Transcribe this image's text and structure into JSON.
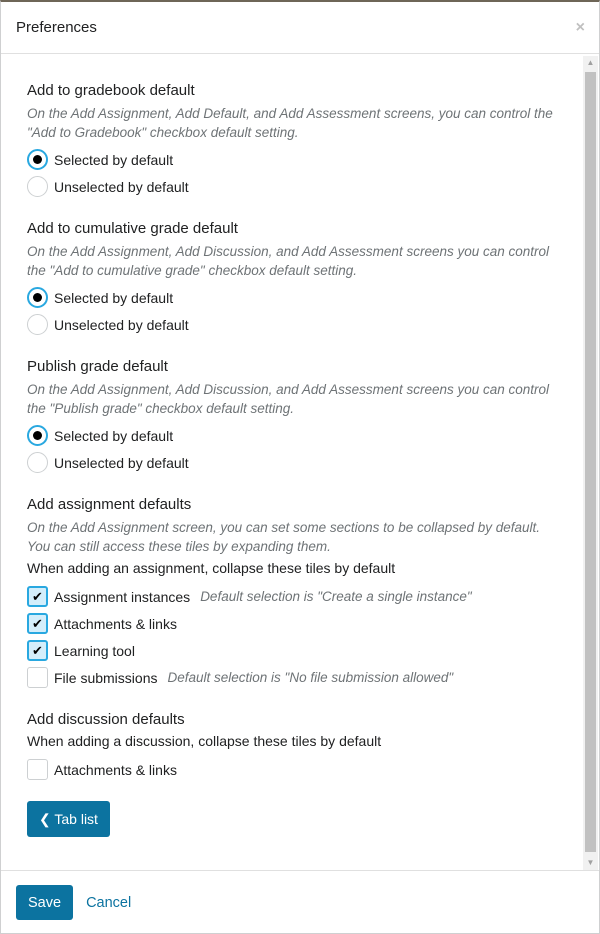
{
  "dialog": {
    "title": "Preferences",
    "close_icon": "×"
  },
  "sections": [
    {
      "heading": "Add to gradebook default",
      "description": "On the Add Assignment, Add Default, and Add Assessment screens, you can control the \"Add to Gradebook\" checkbox default setting.",
      "options": [
        {
          "label": "Selected by default",
          "checked": true
        },
        {
          "label": "Unselected by default",
          "checked": false
        }
      ]
    },
    {
      "heading": "Add to cumulative grade default",
      "description": "On the Add Assignment, Add Discussion, and Add Assessment screens you can control the \"Add to cumulative grade\" checkbox default setting.",
      "options": [
        {
          "label": "Selected by default",
          "checked": true
        },
        {
          "label": "Unselected by default",
          "checked": false
        }
      ]
    },
    {
      "heading": "Publish grade default",
      "description": "On the Add Assignment, Add Discussion, and Add Assessment screens you can control the \"Publish grade\" checkbox default setting.",
      "options": [
        {
          "label": "Selected by default",
          "checked": true
        },
        {
          "label": "Unselected by default",
          "checked": false
        }
      ]
    }
  ],
  "assignment_defaults": {
    "heading": "Add assignment defaults",
    "description": "On the Add Assignment screen, you can set some sections to be collapsed by default. You can still access these tiles by expanding them.",
    "instruction": "When adding an assignment, collapse these tiles by default",
    "items": [
      {
        "label": "Assignment instances",
        "hint": "Default selection is \"Create a single instance\"",
        "checked": true
      },
      {
        "label": "Attachments & links",
        "hint": "",
        "checked": true
      },
      {
        "label": "Learning tool",
        "hint": "",
        "checked": true
      },
      {
        "label": "File submissions",
        "hint": "Default selection is \"No file submission allowed\"",
        "checked": false
      }
    ]
  },
  "discussion_defaults": {
    "heading": "Add discussion defaults",
    "instruction": "When adding a discussion, collapse these tiles by default",
    "items": [
      {
        "label": "Attachments & links",
        "checked": false
      }
    ]
  },
  "tab_list_button": {
    "icon": "❮",
    "label": "Tab list"
  },
  "footer": {
    "save_label": "Save",
    "cancel_label": "Cancel"
  },
  "colors": {
    "primary": "#0c73a0",
    "focus": "#29a8e0"
  }
}
